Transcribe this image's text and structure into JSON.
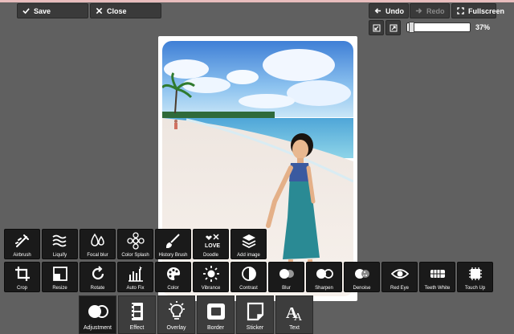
{
  "toolbar": {
    "save_label": "Save",
    "close_label": "Close",
    "undo_label": "Undo",
    "redo_label": "Redo",
    "fullscreen_label": "Fullscreen"
  },
  "zoom": {
    "percent_label": "37%",
    "level": 0.37
  },
  "colors": {
    "background": "#606060",
    "panel": "#1a1a1a",
    "category": "#3d3d3d"
  },
  "tools_row1": [
    {
      "label": "Airbrush",
      "icon": "airbrush-icon"
    },
    {
      "label": "Liquify",
      "icon": "liquify-icon"
    },
    {
      "label": "Focal blur",
      "icon": "focal-blur-icon"
    },
    {
      "label": "Color Splash",
      "icon": "color-splash-icon"
    },
    {
      "label": "History Brush",
      "icon": "history-brush-icon"
    },
    {
      "label": "Doodle",
      "icon": "doodle-icon"
    },
    {
      "label": "Add image",
      "icon": "add-image-icon"
    }
  ],
  "tools_row2": [
    {
      "label": "Crop",
      "icon": "crop-icon"
    },
    {
      "label": "Resize",
      "icon": "resize-icon"
    },
    {
      "label": "Rotate",
      "icon": "rotate-icon"
    },
    {
      "label": "Auto Fix",
      "icon": "auto-fix-icon"
    },
    {
      "label": "Color",
      "icon": "palette-icon"
    },
    {
      "label": "Vibrance",
      "icon": "vibrance-icon"
    },
    {
      "label": "Contrast",
      "icon": "contrast-icon"
    },
    {
      "label": "Blur",
      "icon": "blur-icon"
    },
    {
      "label": "Sharpen",
      "icon": "sharpen-icon"
    },
    {
      "label": "Denoise",
      "icon": "denoise-icon"
    },
    {
      "label": "Red Eye",
      "icon": "eye-icon"
    },
    {
      "label": "Teeth White",
      "icon": "teeth-icon"
    },
    {
      "label": "Touch Up",
      "icon": "touch-up-icon"
    }
  ],
  "categories": [
    {
      "label": "Adjustment",
      "icon": "adjustment-icon",
      "active": true
    },
    {
      "label": "Effect",
      "icon": "film-icon",
      "active": false
    },
    {
      "label": "Overlay",
      "icon": "lightbulb-icon",
      "active": false
    },
    {
      "label": "Border",
      "icon": "border-icon",
      "active": false
    },
    {
      "label": "Sticker",
      "icon": "sticker-icon",
      "active": false
    },
    {
      "label": "Text",
      "icon": "text-icon",
      "active": false
    }
  ]
}
